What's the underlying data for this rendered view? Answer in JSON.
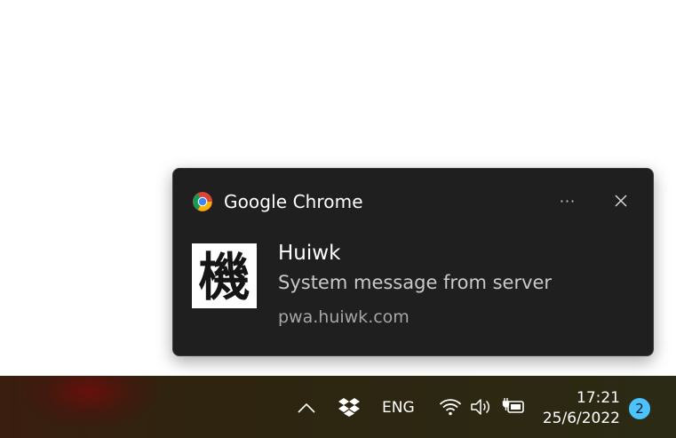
{
  "notification": {
    "app_name": "Google Chrome",
    "title": "Huiwk",
    "message": "System message from server",
    "source": "pwa.huiwk.com",
    "more_label": "···",
    "icon_glyph": "機",
    "icons": {
      "app": "chrome-icon",
      "more": "more-options-icon",
      "close": "close-icon"
    }
  },
  "taskbar": {
    "language": "ENG",
    "time": "17:21",
    "date": "25/6/2022",
    "notification_count": "2",
    "icons": [
      "chevron-up-icon",
      "dropbox-icon",
      "wifi-icon",
      "speaker-icon",
      "battery-charging-icon"
    ],
    "accent_color": "#4cc2ff"
  }
}
